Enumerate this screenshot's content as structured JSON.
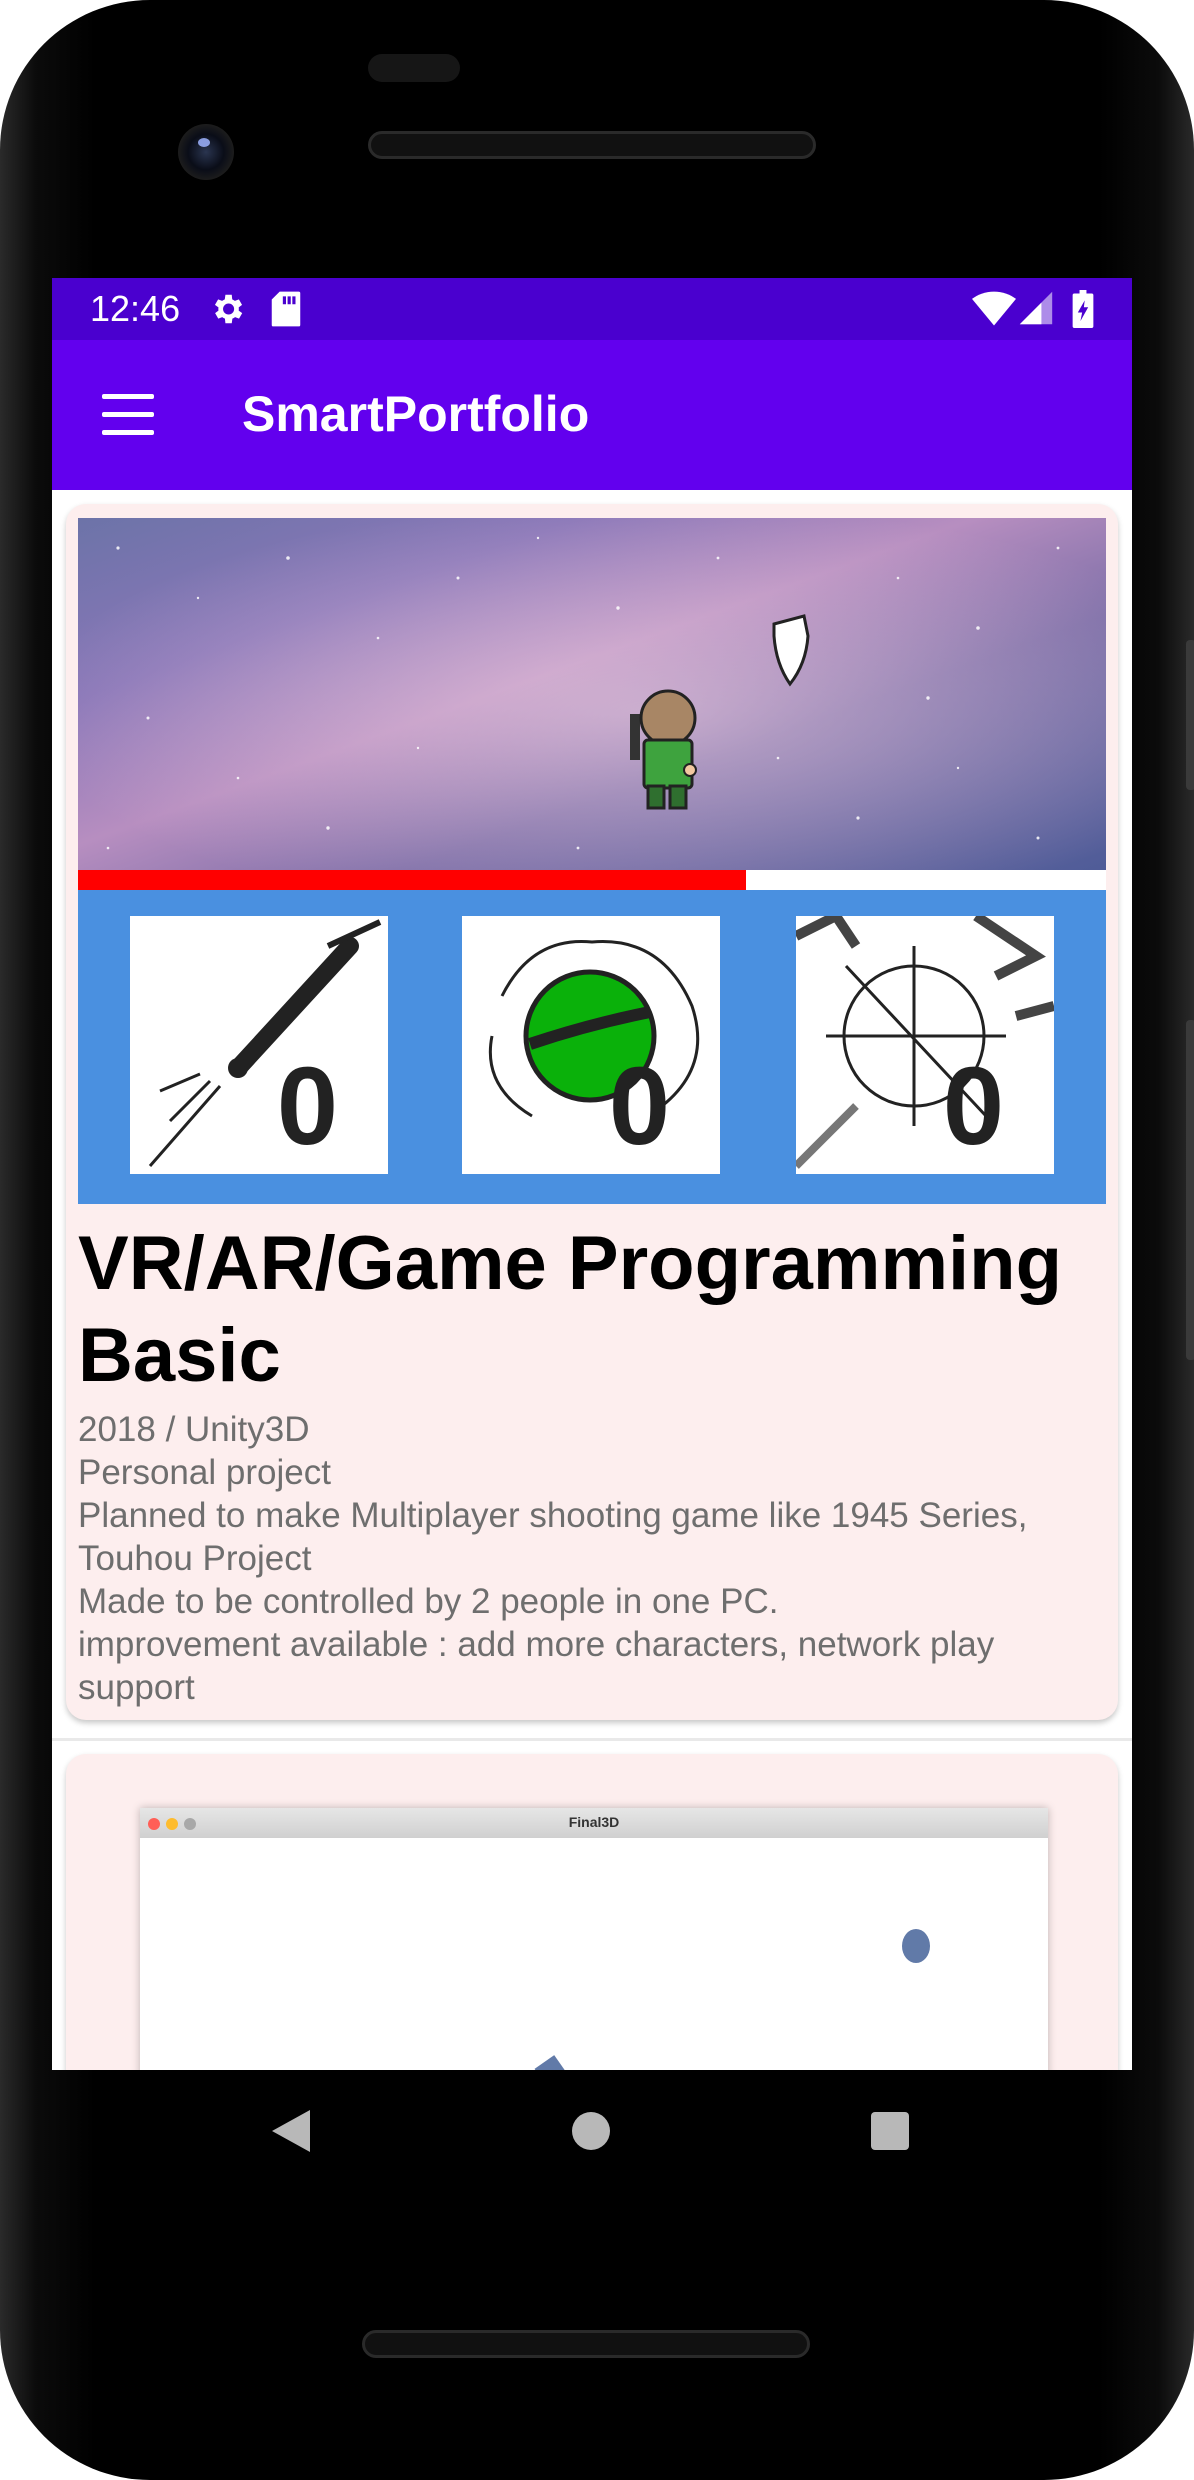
{
  "status_bar": {
    "time": "12:46",
    "icons": [
      "settings-icon",
      "sd-card-icon",
      "wifi-icon",
      "signal-icon",
      "battery-icon"
    ]
  },
  "app_bar": {
    "title": "SmartPortfolio",
    "menu_icon": "hamburger-menu-icon"
  },
  "projects": [
    {
      "title": "VR/AR/Game Programming Basic",
      "meta": "2018 / Unity3D",
      "type": "Personal project",
      "description_1": "Planned to make Multiplayer shooting game like 1945 Series, Touhou Project",
      "description_2": "Made to be controlled by 2 people in one PC.",
      "description_3": "improvement available : add more characters, network play support",
      "screenshot": {
        "health_fraction": 0.65,
        "counters": [
          "0",
          "0",
          "0"
        ],
        "counter_icons": [
          "gun-icon",
          "bomb-icon",
          "crosshair-icon"
        ]
      }
    },
    {
      "screenshot": {
        "window_title": "Final3D"
      }
    }
  ],
  "nav_bar": {
    "back": "back-icon",
    "home": "home-icon",
    "recents": "recents-icon"
  },
  "colors": {
    "status_bar": "#4a00cf",
    "app_bar": "#6200ee",
    "card_background": "#fdeeee",
    "game_panel": "#4a90e0",
    "health": "#ff0000"
  }
}
